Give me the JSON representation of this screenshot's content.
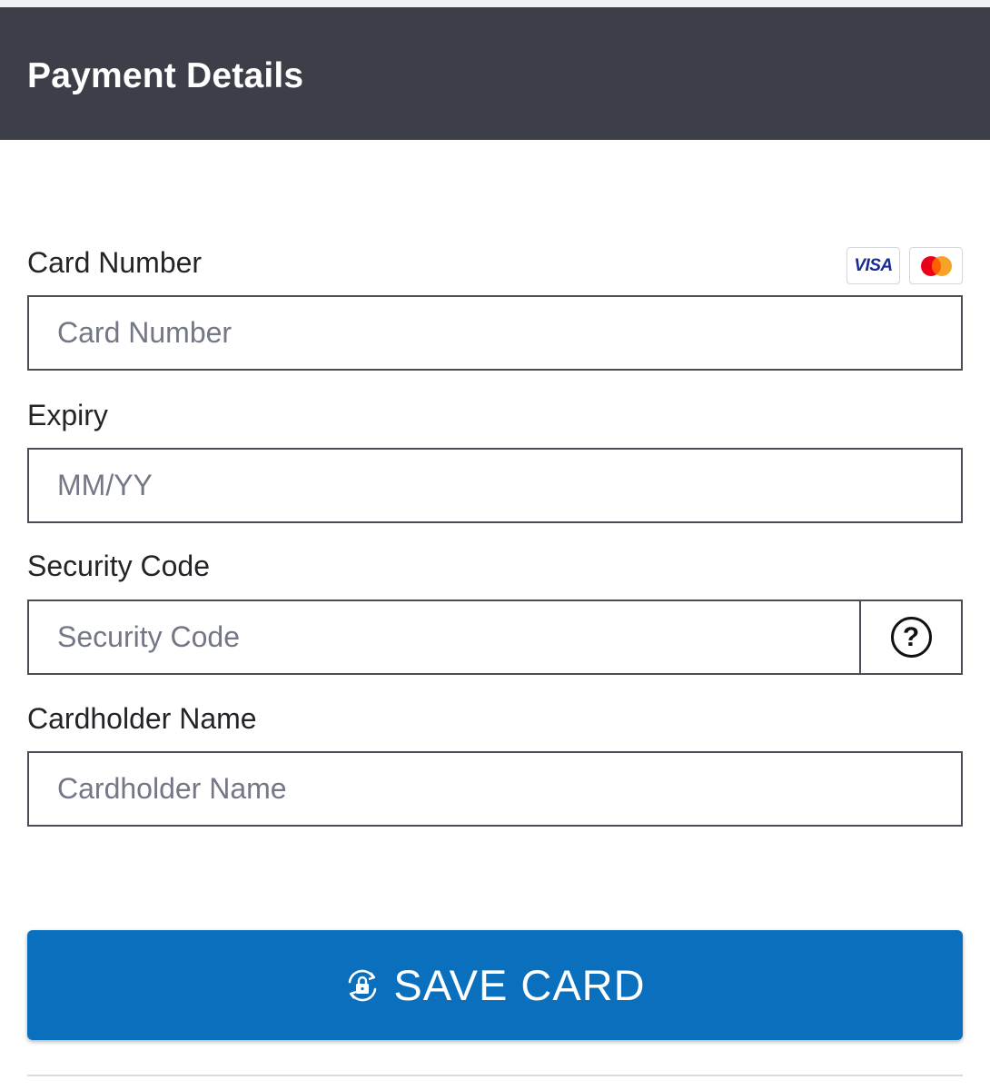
{
  "header": {
    "title": "Payment Details"
  },
  "card_number": {
    "label": "Card Number",
    "placeholder": "Card Number",
    "value": ""
  },
  "card_brands": [
    {
      "name": "visa",
      "text": "VISA"
    },
    {
      "name": "mastercard",
      "text": ""
    }
  ],
  "expiry": {
    "label": "Expiry",
    "placeholder": "MM/YY",
    "value": ""
  },
  "security_code": {
    "label": "Security Code",
    "placeholder": "Security Code",
    "value": "",
    "help_icon": "?"
  },
  "cardholder": {
    "label": "Cardholder Name",
    "placeholder": "Cardholder Name",
    "value": ""
  },
  "save_button": {
    "label": "SAVE CARD",
    "icon": "lock-icon"
  },
  "colors": {
    "header_bg": "#3c3f47",
    "button_bg": "#0a70bd",
    "mastercard_red": "#eb001b",
    "mastercard_orange": "#f79e1b",
    "visa_blue": "#1a2b8f"
  }
}
